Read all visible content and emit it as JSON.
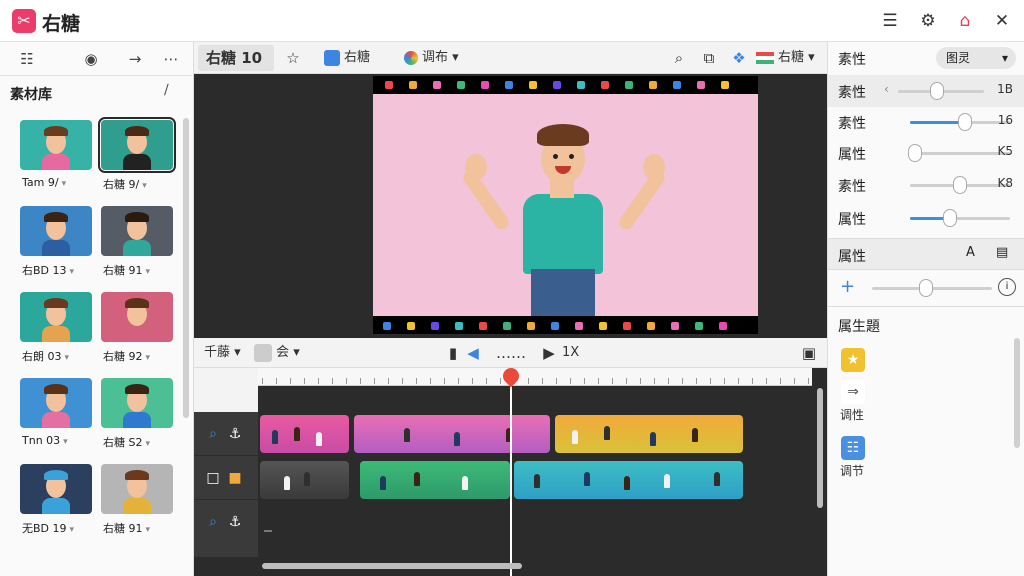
{
  "app": {
    "title": "右糖",
    "logo_icon": "scissors-icon",
    "brand_color": "#ea3d6b"
  },
  "titlebar_icons": [
    "notes-icon",
    "gear-icon",
    "home-icon",
    "close-icon"
  ],
  "left_toolbar": [
    "list-icon",
    "pin-icon",
    "arrow-right-icon",
    "more-icon"
  ],
  "library": {
    "title": "素材库",
    "items": [
      {
        "label": "Tam 9/",
        "bg": "#36b3a6",
        "shirt": "#e66aa0",
        "hair": "#6b3b20"
      },
      {
        "label": "右糖 9/",
        "bg": "#2f9e8f",
        "shirt": "#222222",
        "hair": "#4a2a16",
        "selected": true
      },
      {
        "label": "右BD 13",
        "bg": "#3d86c6",
        "shirt": "#2c5fa1",
        "hair": "#3b2414"
      },
      {
        "label": "右糖 91",
        "bg": "#555c66",
        "shirt": "#2fa79a",
        "hair": "#2a1a10"
      },
      {
        "label": "右朗 03",
        "bg": "#2ba79c",
        "shirt": "#e3a34f",
        "hair": "#6b3a1e"
      },
      {
        "label": "右糖 92",
        "bg": "#d3607c",
        "shirt": "#d3607c",
        "hair": "#5a3218"
      },
      {
        "label": "Tnn 03",
        "bg": "#3f91d4",
        "shirt": "#e46fa3",
        "hair": "#5a3218"
      },
      {
        "label": "右糖 S2",
        "bg": "#4dbf94",
        "shirt": "#2e7ad1",
        "hair": "#3a2414"
      },
      {
        "label": "无BD 19",
        "bg": "#2b3f5e",
        "shirt": "#3aa1d9",
        "hair": "#3aa1d9"
      },
      {
        "label": "右糖 91",
        "bg": "#b5b5b5",
        "shirt": "#e4b13b",
        "hair": "#6b3a1e"
      }
    ]
  },
  "toolbar": {
    "tab_label": "右糖 10",
    "star_icon": "star-icon",
    "btn1_label": "右糖",
    "btn2_label": "调布",
    "btn3_label": "右糖",
    "icons": [
      "search-icon",
      "crop-icon",
      "effects-icon",
      "flag-icon"
    ]
  },
  "timeline_bar": {
    "left_label": "千藤",
    "mid_label": "会",
    "speed_label": "1X"
  },
  "right_panel": {
    "header_label": "素性",
    "header_dropdown": "图灵",
    "rows": [
      {
        "label": "素性",
        "value": "1B",
        "level": 0.45,
        "filled": false
      },
      {
        "label": "素性",
        "value": "16",
        "level": 0.55,
        "filled": true
      },
      {
        "label": "属性",
        "value": "K5",
        "level": 0.05,
        "filled": false
      },
      {
        "label": "素性",
        "value": "K8",
        "level": 0.5,
        "filled": false
      },
      {
        "label": "属性",
        "value": "",
        "level": 0.4,
        "filled": true
      }
    ],
    "section2_label": "属性",
    "section2_level": 0.45,
    "section3_label": "属生題",
    "props": [
      {
        "label": "",
        "icon": "sticker-icon",
        "color": "#f1c230"
      },
      {
        "label": "调性",
        "icon": "arrow-right-icon",
        "color": "#ffffff"
      },
      {
        "label": "调节",
        "icon": "document-icon",
        "color": "#4a8fe0"
      }
    ]
  }
}
